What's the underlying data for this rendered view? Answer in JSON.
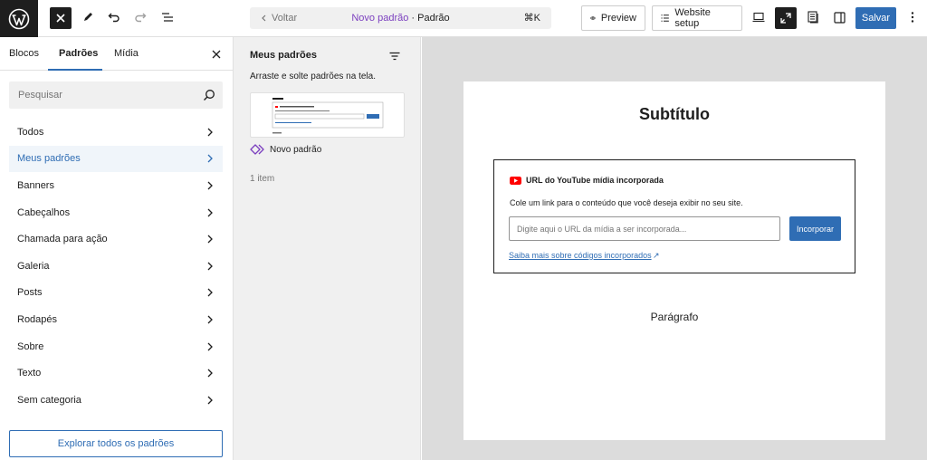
{
  "topbar": {
    "back_label": "Voltar",
    "doc_name": "Novo padrão",
    "doc_separator": "·",
    "doc_type": "Padrão",
    "shortcut": "⌘K",
    "preview_label": "Preview",
    "website_setup_label": "Website setup",
    "save_label": "Salvar"
  },
  "sidebar": {
    "tabs": [
      "Blocos",
      "Padrões",
      "Mídia"
    ],
    "active_tab": "Padrões",
    "search_placeholder": "Pesquisar",
    "categories": [
      "Todos",
      "Meus padrões",
      "Banners",
      "Cabeçalhos",
      "Chamada para ação",
      "Galeria",
      "Posts",
      "Rodapés",
      "Sobre",
      "Texto",
      "Sem categoria"
    ],
    "active_category": "Meus padrões",
    "explore_label": "Explorar todos os padrões"
  },
  "patterns_panel": {
    "title": "Meus padrões",
    "description": "Arraste e solte padrões na tela.",
    "pattern_name": "Novo padrão",
    "count": "1 item"
  },
  "canvas": {
    "heading": "Subtítulo",
    "embed": {
      "title": "URL do YouTube mídia incorporada",
      "description": "Cole um link para o conteúdo que você deseja exibir no seu site.",
      "input_placeholder": "Digite aqui o URL da mídia a ser incorporada...",
      "button_label": "Incorporar",
      "learn_more": "Saiba mais sobre códigos incorporados",
      "learn_more_arrow": "↗"
    },
    "paragraph": "Parágrafo"
  },
  "colors": {
    "accent": "#2f6db4",
    "dark": "#1e1e1e",
    "pattern_purple": "#7b3fbf",
    "youtube_red": "#ff0000"
  },
  "icons": [
    "wordpress-logo",
    "close-icon",
    "pencil-icon",
    "undo-icon",
    "redo-icon",
    "list-view-icon",
    "chevron-left-icon",
    "eye-icon",
    "list-icon",
    "desktop-icon",
    "fullscreen-icon",
    "document-icon",
    "sidebar-icon",
    "more-vertical-icon",
    "search-icon",
    "chevron-right-icon",
    "filter-icon",
    "pattern-icon",
    "youtube-icon"
  ]
}
